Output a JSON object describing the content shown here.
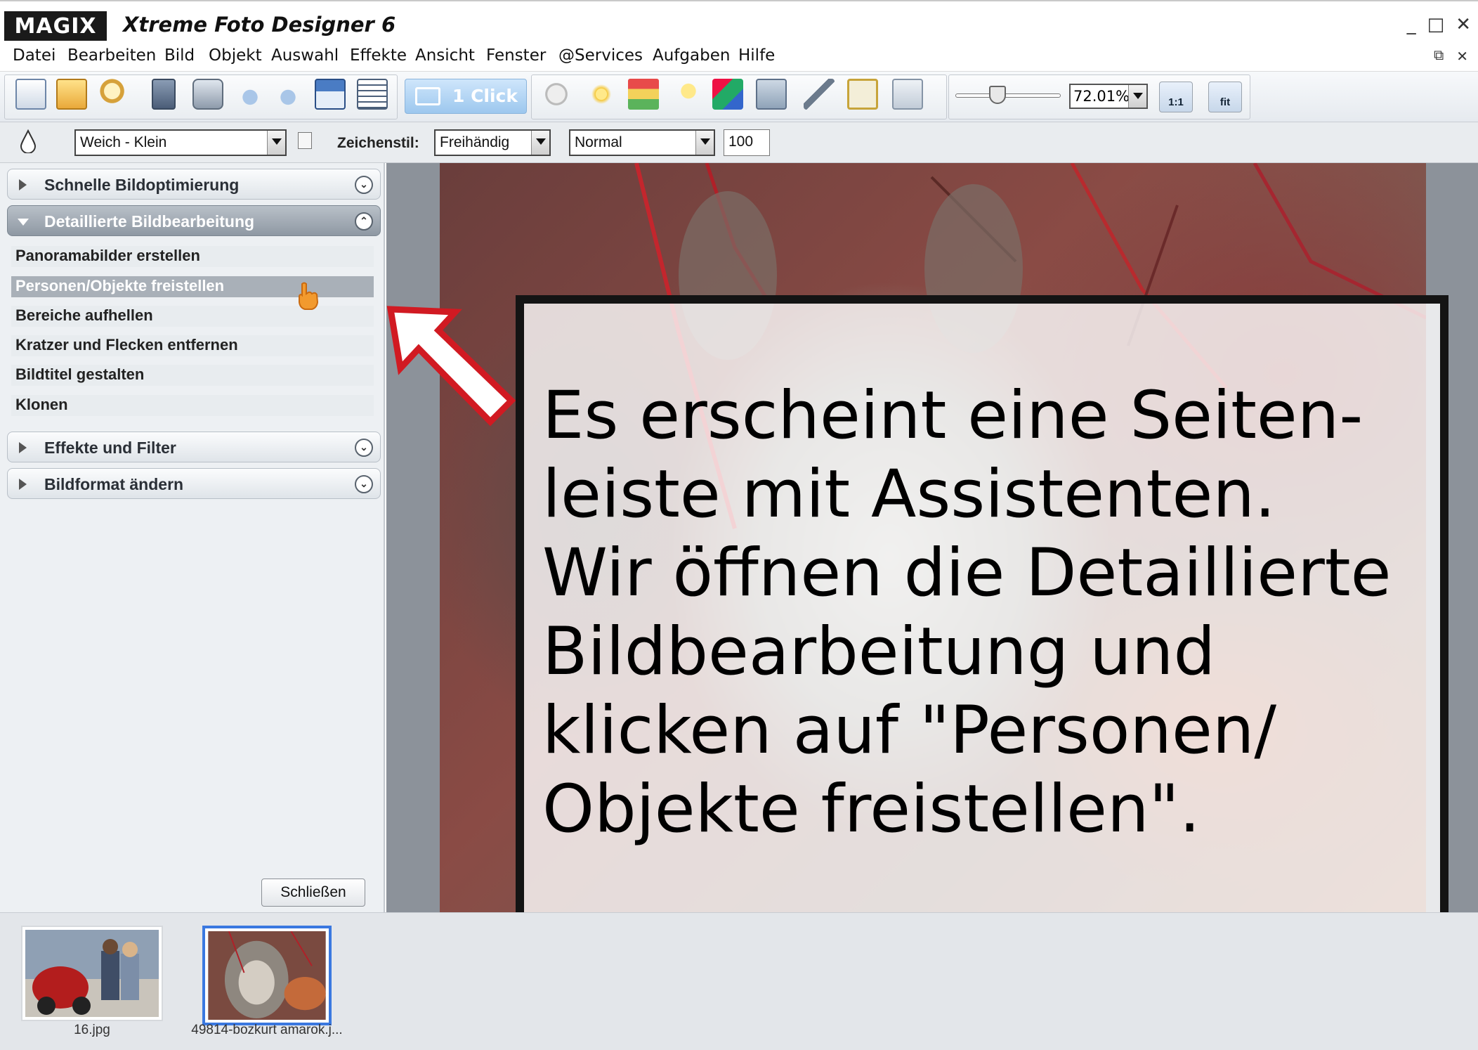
{
  "app": {
    "logo": "MAGIX",
    "title": "Xtreme Foto Designer 6",
    "window_controls": [
      "_",
      "□",
      "✕"
    ]
  },
  "menu": {
    "items": [
      "Datei",
      "Bearbeiten",
      "Bild",
      "Objekt",
      "Auswahl",
      "Effekte",
      "Ansicht",
      "Fenster",
      "@Services",
      "Aufgaben",
      "Hilfe"
    ],
    "right_controls": [
      "⧉",
      "✕"
    ]
  },
  "toolbar": {
    "icons": [
      "new-file-icon",
      "open-folder-icon",
      "browse-icon",
      "save-icon",
      "print-icon",
      "undo-icon",
      "redo-icon",
      "view-icon",
      "list-icon",
      "crop-icon",
      "brightness-icon",
      "color-icon",
      "lightbulb-icon",
      "colors-icon",
      "frame-icon",
      "edit-icon",
      "fullscreen-icon",
      "fx-icon"
    ],
    "one_click_label": "1 Click",
    "zoom_value": "72.01%",
    "zoom_100_label": "1:1",
    "zoom_fit_label": "fit",
    "zoom_slider_fraction": 0.45
  },
  "options": {
    "brush_value": "Weich - Klein",
    "drawing_style_label": "Zeichenstil:",
    "drawing_style_value": "Freihändig",
    "blend_value": "Normal",
    "opacity_value": "100"
  },
  "sidebar": {
    "sections": [
      {
        "label": "Schnelle Bildoptimierung",
        "expanded": false
      },
      {
        "label": "Detaillierte Bildbearbeitung",
        "expanded": true
      },
      {
        "label": "Effekte und Filter",
        "expanded": false
      },
      {
        "label": "Bildformat ändern",
        "expanded": false
      }
    ],
    "tasks": [
      "Panoramabilder erstellen",
      "Personen/Objekte freistellen",
      "Bereiche aufhellen",
      "Kratzer und Flecken entfernen",
      "Bildtitel gestalten",
      "Klonen"
    ],
    "highlighted_task": "Personen/Objekte freistellen",
    "close_label": "Schließen"
  },
  "callout": {
    "text": "Es erscheint eine Seiten-\nleiste mit Assistenten.\nWir öffnen die Detaillierte\nBildbearbeitung und\nklicken auf \"Personen/\nObjekte freistellen\"."
  },
  "filmstrip": {
    "thumbs": [
      {
        "caption": "16.jpg",
        "selected": false
      },
      {
        "caption": "49814-bozkurt amarok.j...",
        "selected": true
      }
    ]
  },
  "colors": {
    "accent_blue": "#3a78e0",
    "arrow_red": "#d11a22",
    "callout_border": "#141414"
  }
}
